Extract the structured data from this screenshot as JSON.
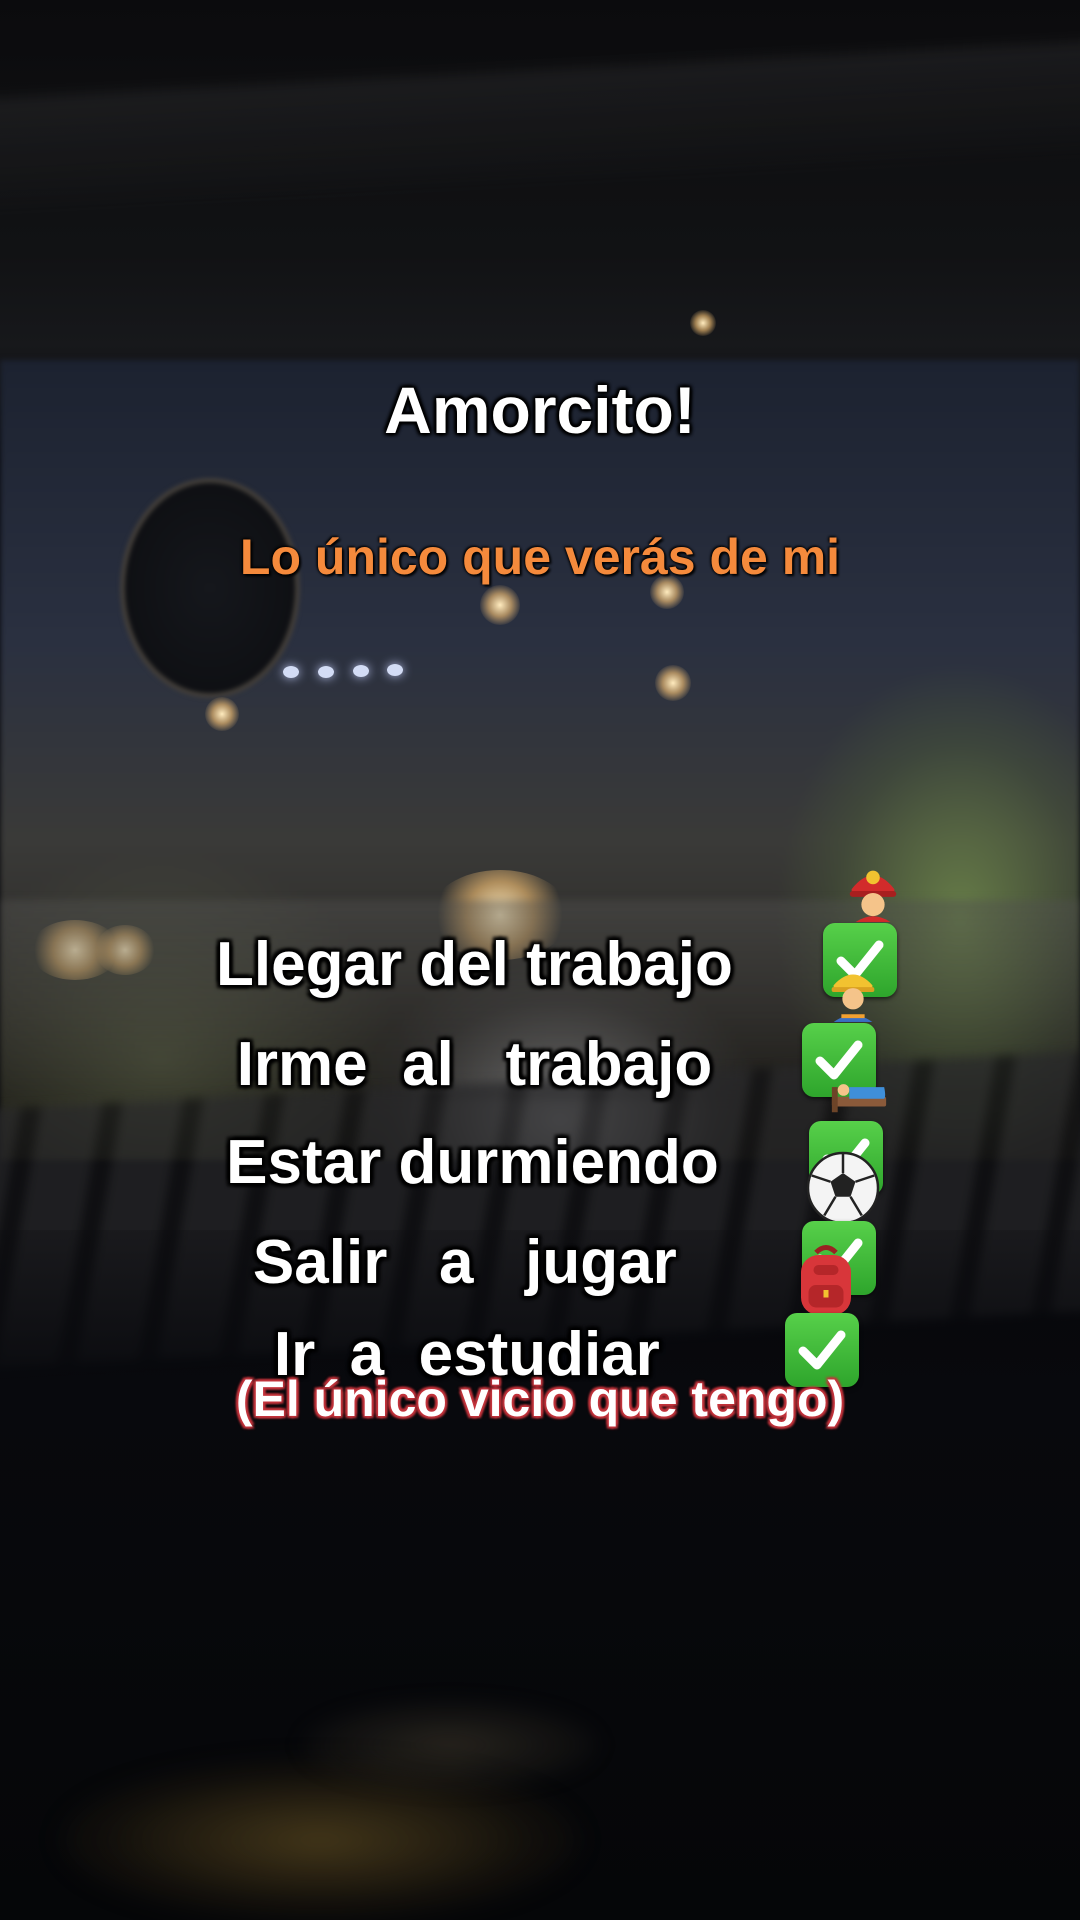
{
  "title": "Amorcito!",
  "subtitle": "Lo único que verás de mi",
  "list": [
    {
      "text": "Llegar del trabajo",
      "icon": "firefighter-icon"
    },
    {
      "text": "Irme  al   trabajo",
      "icon": "construction-worker-icon"
    },
    {
      "text": "Estar durmiendo",
      "icon": "person-in-bed-icon"
    },
    {
      "text": "Salir   a   jugar ",
      "icon": "soccer-ball-icon"
    },
    {
      "text": "Ir  a  estudiar ",
      "icon": "backpack-icon"
    }
  ],
  "footer": "(El único vicio que tengo)",
  "colors": {
    "title": "#ffffff",
    "subtitle": "#f58a3c",
    "check": "#3fbf3a",
    "footer_outline": "#c4343c"
  }
}
